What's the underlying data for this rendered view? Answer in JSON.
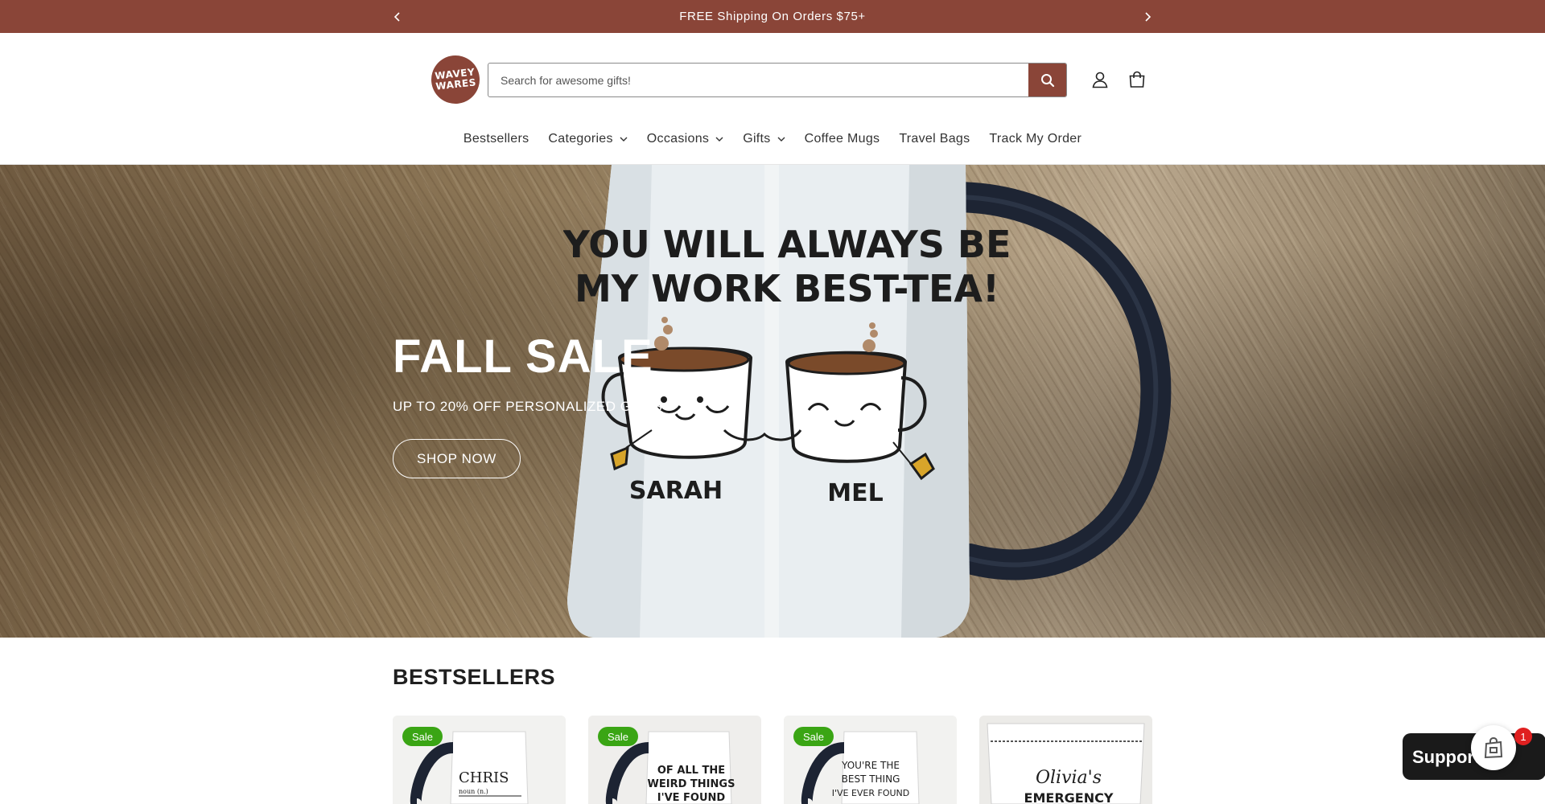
{
  "announcement": {
    "text": "FREE Shipping On Orders $75+",
    "prev_icon": "chevron-left-icon",
    "next_icon": "chevron-right-icon"
  },
  "header": {
    "logo_line1": "WAVEY",
    "logo_line2": "WARES",
    "search_placeholder": "Search for awesome gifts!",
    "search_icon": "search-icon",
    "account_icon": "user-icon",
    "cart_icon": "cart-icon",
    "nav": [
      {
        "label": "Bestsellers",
        "dropdown": false
      },
      {
        "label": "Categories",
        "dropdown": true
      },
      {
        "label": "Occasions",
        "dropdown": true
      },
      {
        "label": "Gifts",
        "dropdown": true
      },
      {
        "label": "Coffee Mugs",
        "dropdown": false
      },
      {
        "label": "Travel Bags",
        "dropdown": false
      },
      {
        "label": "Track My Order",
        "dropdown": false
      }
    ]
  },
  "hero": {
    "title": "FALL SALE",
    "subtitle": "UP TO 20% OFF PERSONALIZED GIFTS",
    "button": "SHOP NOW",
    "mug_line1": "YOU WILL ALWAYS BE",
    "mug_line2": "MY WORK BEST-TEA!",
    "mug_name1": "SARAH",
    "mug_name2": "MEL"
  },
  "bestsellers": {
    "title": "BESTSELLERS",
    "products": [
      {
        "badge": "Sale",
        "art_text": [
          "CHRIS",
          "noun (n.)"
        ]
      },
      {
        "badge": "Sale",
        "art_text": [
          "OF ALL THE",
          "WEIRD THINGS",
          "I'VE FOUND"
        ]
      },
      {
        "badge": "Sale",
        "art_text": [
          "YOU'RE THE",
          "BEST THING",
          "I'VE EVER FOUND"
        ]
      },
      {
        "badge": "",
        "art_text": [
          "Olivia's",
          "EMERGENCY"
        ]
      }
    ]
  },
  "chat": {
    "label": "Support",
    "count": "1",
    "icon": "shopping-bag-icon"
  }
}
